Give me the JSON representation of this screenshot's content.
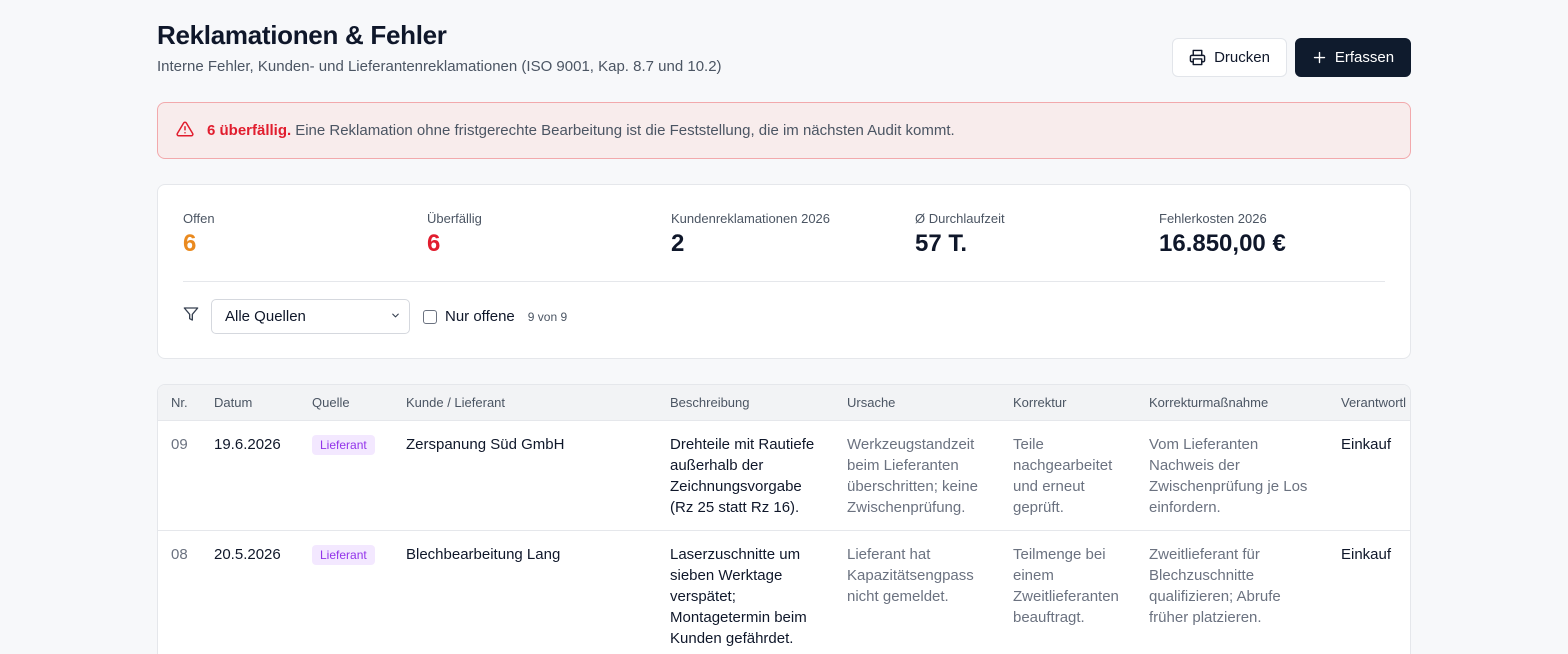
{
  "header": {
    "title": "Reklamationen & Fehler",
    "subtitle": "Interne Fehler, Kunden- und Lieferantenreklamationen (ISO 9001, Kap. 8.7 und 10.2)",
    "print_label": "Drucken",
    "add_label": "Erfassen"
  },
  "alert": {
    "strong": "6 überfällig.",
    "text": "Eine Reklamation ohne fristgerechte Bearbeitung ist die Feststellung, die im nächsten Audit kommt."
  },
  "stats": [
    {
      "label": "Offen",
      "value": "6",
      "color": "#ea8a1f"
    },
    {
      "label": "Überfällig",
      "value": "6",
      "color": "#e11d2e"
    },
    {
      "label": "Kundenreklamationen 2026",
      "value": "2",
      "color": "#0f172a"
    },
    {
      "label": "Ø Durchlaufzeit",
      "value": "57 T.",
      "color": "#0f172a"
    },
    {
      "label": "Fehlerkosten 2026",
      "value": "16.850,00 €",
      "color": "#0f172a"
    }
  ],
  "filter": {
    "source_selected": "Alle Quellen",
    "only_open_label": "Nur offene",
    "only_open_checked": false,
    "count": "9 von 9"
  },
  "table": {
    "columns": [
      "Nr.",
      "Datum",
      "Quelle",
      "Kunde / Lieferant",
      "Beschreibung",
      "Ursache",
      "Korrektur",
      "Korrekturmaßnahme",
      "Verantwortl"
    ],
    "rows": [
      {
        "nr": "09",
        "datum": "19.6.2026",
        "quelle": "Lieferant",
        "partner": "Zerspanung Süd GmbH",
        "beschreibung": [
          "Drehteile mit Rautiefe",
          "außerhalb der",
          "Zeichnungsvorgabe",
          "(Rz 25 statt Rz 16)."
        ],
        "ursache": [
          "Werkzeugstandzeit",
          "beim Lieferanten",
          "überschritten; keine",
          "Zwischenprüfung."
        ],
        "korrektur": [
          "Teile",
          "nachgearbeitet",
          "und erneut",
          "geprüft."
        ],
        "massnahme": [
          "Vom Lieferanten",
          "Nachweis der",
          "Zwischenprüfung je Los",
          "einfordern."
        ],
        "verantwortlich": "Einkauf"
      },
      {
        "nr": "08",
        "datum": "20.5.2026",
        "quelle": "Lieferant",
        "partner": "Blechbearbeitung Lang",
        "beschreibung": [
          "Laserzuschnitte um",
          "sieben Werktage",
          "verspätet;",
          "Montagetermin beim",
          "Kunden gefährdet."
        ],
        "ursache": [
          "Lieferant hat",
          "Kapazitätsengpass",
          "nicht gemeldet."
        ],
        "korrektur": [
          "Teilmenge bei",
          "einem",
          "Zweitlieferanten",
          "beauftragt."
        ],
        "massnahme": [
          "Zweitlieferant für",
          "Blechzuschnitte",
          "qualifizieren; Abrufe",
          "früher platzieren."
        ],
        "verantwortlich": "Einkauf"
      }
    ]
  }
}
